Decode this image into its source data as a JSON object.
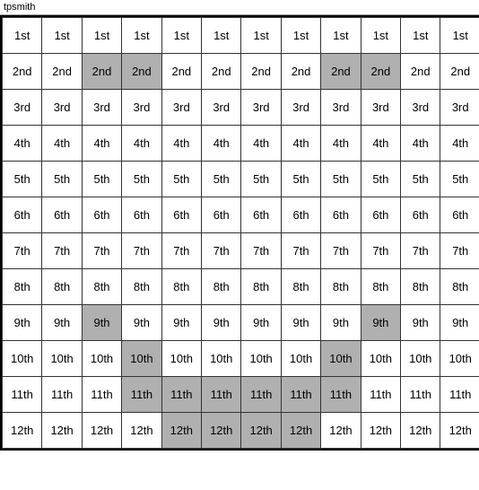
{
  "title": "tpsmith",
  "columns": 12,
  "rows": [
    {
      "label": "1st",
      "cells": [
        {
          "text": "1st",
          "hl": false
        },
        {
          "text": "1st",
          "hl": false
        },
        {
          "text": "1st",
          "hl": false
        },
        {
          "text": "1st",
          "hl": false
        },
        {
          "text": "1st",
          "hl": false
        },
        {
          "text": "1st",
          "hl": false
        },
        {
          "text": "1st",
          "hl": false
        },
        {
          "text": "1st",
          "hl": false
        },
        {
          "text": "1st",
          "hl": false
        },
        {
          "text": "1st",
          "hl": false
        },
        {
          "text": "1st",
          "hl": false
        },
        {
          "text": "1st",
          "hl": false
        }
      ]
    },
    {
      "label": "2nd",
      "cells": [
        {
          "text": "2nd",
          "hl": false
        },
        {
          "text": "2nd",
          "hl": false
        },
        {
          "text": "2nd",
          "hl": true
        },
        {
          "text": "2nd",
          "hl": true
        },
        {
          "text": "2nd",
          "hl": false
        },
        {
          "text": "2nd",
          "hl": false
        },
        {
          "text": "2nd",
          "hl": false
        },
        {
          "text": "2nd",
          "hl": false
        },
        {
          "text": "2nd",
          "hl": true
        },
        {
          "text": "2nd",
          "hl": true
        },
        {
          "text": "2nd",
          "hl": false
        },
        {
          "text": "2nd",
          "hl": false
        }
      ]
    },
    {
      "label": "3rd",
      "cells": [
        {
          "text": "3rd",
          "hl": false
        },
        {
          "text": "3rd",
          "hl": false
        },
        {
          "text": "3rd",
          "hl": false
        },
        {
          "text": "3rd",
          "hl": false
        },
        {
          "text": "3rd",
          "hl": false
        },
        {
          "text": "3rd",
          "hl": false
        },
        {
          "text": "3rd",
          "hl": false
        },
        {
          "text": "3rd",
          "hl": false
        },
        {
          "text": "3rd",
          "hl": false
        },
        {
          "text": "3rd",
          "hl": false
        },
        {
          "text": "3rd",
          "hl": false
        },
        {
          "text": "3rd",
          "hl": false
        }
      ]
    },
    {
      "label": "4th",
      "cells": [
        {
          "text": "4th",
          "hl": false
        },
        {
          "text": "4th",
          "hl": false
        },
        {
          "text": "4th",
          "hl": false
        },
        {
          "text": "4th",
          "hl": false
        },
        {
          "text": "4th",
          "hl": false
        },
        {
          "text": "4th",
          "hl": false
        },
        {
          "text": "4th",
          "hl": false
        },
        {
          "text": "4th",
          "hl": false
        },
        {
          "text": "4th",
          "hl": false
        },
        {
          "text": "4th",
          "hl": false
        },
        {
          "text": "4th",
          "hl": false
        },
        {
          "text": "4th",
          "hl": false
        }
      ]
    },
    {
      "label": "5th",
      "cells": [
        {
          "text": "5th",
          "hl": false
        },
        {
          "text": "5th",
          "hl": false
        },
        {
          "text": "5th",
          "hl": false
        },
        {
          "text": "5th",
          "hl": false
        },
        {
          "text": "5th",
          "hl": false
        },
        {
          "text": "5th",
          "hl": false
        },
        {
          "text": "5th",
          "hl": false
        },
        {
          "text": "5th",
          "hl": false
        },
        {
          "text": "5th",
          "hl": false
        },
        {
          "text": "5th",
          "hl": false
        },
        {
          "text": "5th",
          "hl": false
        },
        {
          "text": "5th",
          "hl": false
        }
      ]
    },
    {
      "label": "6th",
      "cells": [
        {
          "text": "6th",
          "hl": false
        },
        {
          "text": "6th",
          "hl": false
        },
        {
          "text": "6th",
          "hl": false
        },
        {
          "text": "6th",
          "hl": false
        },
        {
          "text": "6th",
          "hl": false
        },
        {
          "text": "6th",
          "hl": false
        },
        {
          "text": "6th",
          "hl": false
        },
        {
          "text": "6th",
          "hl": false
        },
        {
          "text": "6th",
          "hl": false
        },
        {
          "text": "6th",
          "hl": false
        },
        {
          "text": "6th",
          "hl": false
        },
        {
          "text": "6th",
          "hl": false
        }
      ]
    },
    {
      "label": "7th",
      "cells": [
        {
          "text": "7th",
          "hl": false
        },
        {
          "text": "7th",
          "hl": false
        },
        {
          "text": "7th",
          "hl": false
        },
        {
          "text": "7th",
          "hl": false
        },
        {
          "text": "7th",
          "hl": false
        },
        {
          "text": "7th",
          "hl": false
        },
        {
          "text": "7th",
          "hl": false
        },
        {
          "text": "7th",
          "hl": false
        },
        {
          "text": "7th",
          "hl": false
        },
        {
          "text": "7th",
          "hl": false
        },
        {
          "text": "7th",
          "hl": false
        },
        {
          "text": "7th",
          "hl": false
        }
      ]
    },
    {
      "label": "8th",
      "cells": [
        {
          "text": "8th",
          "hl": false
        },
        {
          "text": "8th",
          "hl": false
        },
        {
          "text": "8th",
          "hl": false
        },
        {
          "text": "8th",
          "hl": false
        },
        {
          "text": "8th",
          "hl": false
        },
        {
          "text": "8th",
          "hl": false
        },
        {
          "text": "8th",
          "hl": false
        },
        {
          "text": "8th",
          "hl": false
        },
        {
          "text": "8th",
          "hl": false
        },
        {
          "text": "8th",
          "hl": false
        },
        {
          "text": "8th",
          "hl": false
        },
        {
          "text": "8th",
          "hl": false
        }
      ]
    },
    {
      "label": "9th",
      "cells": [
        {
          "text": "9th",
          "hl": false
        },
        {
          "text": "9th",
          "hl": false
        },
        {
          "text": "9th",
          "hl": true
        },
        {
          "text": "9th",
          "hl": false
        },
        {
          "text": "9th",
          "hl": false
        },
        {
          "text": "9th",
          "hl": false
        },
        {
          "text": "9th",
          "hl": false
        },
        {
          "text": "9th",
          "hl": false
        },
        {
          "text": "9th",
          "hl": false
        },
        {
          "text": "9th",
          "hl": true
        },
        {
          "text": "9th",
          "hl": false
        },
        {
          "text": "9th",
          "hl": false
        }
      ]
    },
    {
      "label": "10th",
      "cells": [
        {
          "text": "10th",
          "hl": false
        },
        {
          "text": "10th",
          "hl": false
        },
        {
          "text": "10th",
          "hl": false
        },
        {
          "text": "10th",
          "hl": true
        },
        {
          "text": "10th",
          "hl": false
        },
        {
          "text": "10th",
          "hl": false
        },
        {
          "text": "10th",
          "hl": false
        },
        {
          "text": "10th",
          "hl": false
        },
        {
          "text": "10th",
          "hl": true
        },
        {
          "text": "10th",
          "hl": false
        },
        {
          "text": "10th",
          "hl": false
        },
        {
          "text": "10th",
          "hl": false
        }
      ]
    },
    {
      "label": "11th",
      "cells": [
        {
          "text": "11th",
          "hl": false
        },
        {
          "text": "11th",
          "hl": false
        },
        {
          "text": "11th",
          "hl": false
        },
        {
          "text": "11th",
          "hl": true
        },
        {
          "text": "11th",
          "hl": true
        },
        {
          "text": "11th",
          "hl": true
        },
        {
          "text": "11th",
          "hl": true
        },
        {
          "text": "11th",
          "hl": true
        },
        {
          "text": "11th",
          "hl": true
        },
        {
          "text": "11th",
          "hl": false
        },
        {
          "text": "11th",
          "hl": false
        },
        {
          "text": "11th",
          "hl": false
        }
      ]
    },
    {
      "label": "12th",
      "cells": [
        {
          "text": "12th",
          "hl": false
        },
        {
          "text": "12th",
          "hl": false
        },
        {
          "text": "12th",
          "hl": false
        },
        {
          "text": "12th",
          "hl": false
        },
        {
          "text": "12th",
          "hl": true
        },
        {
          "text": "12th",
          "hl": true
        },
        {
          "text": "12th",
          "hl": true
        },
        {
          "text": "12th",
          "hl": true
        },
        {
          "text": "12th",
          "hl": false
        },
        {
          "text": "12th",
          "hl": false
        },
        {
          "text": "12th",
          "hl": false
        },
        {
          "text": "12th",
          "hl": false
        }
      ]
    }
  ]
}
